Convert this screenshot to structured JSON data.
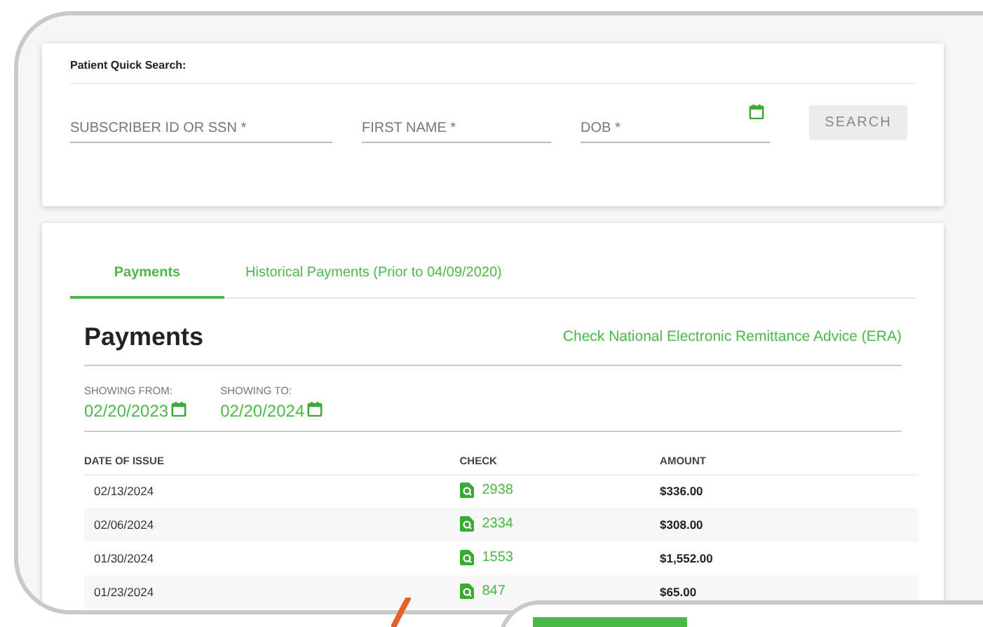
{
  "search_card": {
    "title": "Patient Quick Search:",
    "fields": [
      {
        "placeholder": "SUBSCRIBER ID OR SSN *",
        "kind": "text"
      },
      {
        "placeholder": "FIRST NAME *",
        "kind": "text"
      },
      {
        "placeholder": "DOB *",
        "kind": "date"
      }
    ],
    "button": {
      "label": "SEARCH",
      "disabled": true
    }
  },
  "tabs": [
    {
      "label": "Payments",
      "selected": true
    },
    {
      "label": "Historical Payments (Prior to 04/09/2020)",
      "selected": false
    }
  ],
  "payments": {
    "title": "Payments",
    "era_link": "Check National Electronic Remittance Advice (ERA)",
    "ranges": [
      {
        "label": "SHOWING FROM:",
        "value": "02/20/2023"
      },
      {
        "label": "SHOWING TO:",
        "value": "02/20/2024"
      }
    ]
  },
  "table": {
    "columns": [
      "DATE OF ISSUE",
      "CHECK",
      "AMOUNT"
    ],
    "rows": [
      {
        "date": "02/13/2024",
        "check": "2938",
        "amount": "$336.00"
      },
      {
        "date": "02/06/2024",
        "check": "2334",
        "amount": "$308.00"
      },
      {
        "date": "01/30/2024",
        "check": "1553",
        "amount": "$1,552.00"
      },
      {
        "date": "01/23/2024",
        "check": "847",
        "amount": "$65.00"
      }
    ]
  }
}
